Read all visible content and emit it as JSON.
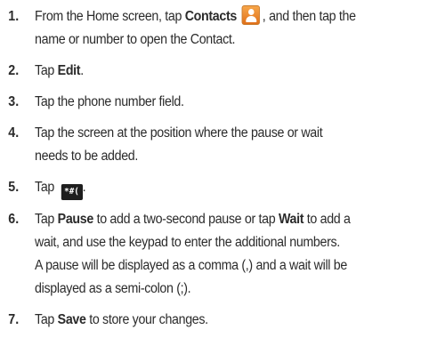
{
  "steps": [
    {
      "num": "1.",
      "line1_a": "From the Home screen, tap ",
      "line1_bold": "Contacts",
      "contacts_icon": "contacts-person-icon",
      "line1_b": ", and then tap the",
      "line2": "name or number to open the Contact."
    },
    {
      "num": "2.",
      "a": "Tap ",
      "bold": "Edit",
      "b": "."
    },
    {
      "num": "3.",
      "text": "Tap the phone number field."
    },
    {
      "num": "4.",
      "line1": "Tap the screen at the position where the pause or wait",
      "line2": "needs to be added."
    },
    {
      "num": "5.",
      "a": "Tap ",
      "key_label": "*#(",
      "b": "."
    },
    {
      "num": "6.",
      "a": "Tap ",
      "bold1": "Pause",
      "b": " to add a two-second pause or tap ",
      "bold2": "Wait",
      "c": " to add a",
      "line2": "wait, and use the keypad to enter the additional numbers.",
      "line3": "A pause will be displayed as a comma (,) and a wait will be",
      "line4": "displayed as a semi-colon (;)."
    },
    {
      "num": "7.",
      "a": "Tap ",
      "bold": "Save",
      "b": " to store your changes."
    }
  ],
  "colors": {
    "text": "#2b2b2b",
    "contacts_icon": "#e8801f",
    "key_icon_bg": "#1e1e1e"
  }
}
